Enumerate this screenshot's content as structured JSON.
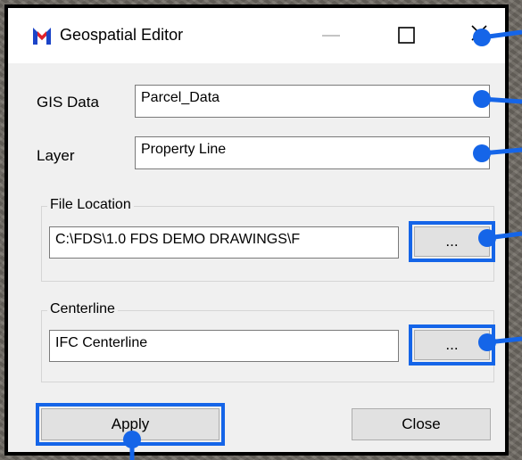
{
  "window": {
    "title": "Geospatial Editor",
    "minimize_glyph": "—",
    "maximize_glyph": "☐",
    "close_glyph": "✕"
  },
  "form": {
    "gis_data_label": "GIS Data",
    "gis_data_value": "Parcel_Data",
    "layer_label": "Layer",
    "layer_value": "Property Line"
  },
  "file_location": {
    "legend": "File Location",
    "path": "C:\\FDS\\1.0 FDS DEMO DRAWINGS\\F",
    "browse_label": "..."
  },
  "centerline": {
    "legend": "Centerline",
    "value": "IFC Centerline",
    "browse_label": "..."
  },
  "actions": {
    "apply_label": "Apply",
    "close_label": "Close"
  },
  "colors": {
    "annotation_blue": "#1565e8",
    "logo_blue": "#1b44c8",
    "logo_red": "#e0202a"
  }
}
